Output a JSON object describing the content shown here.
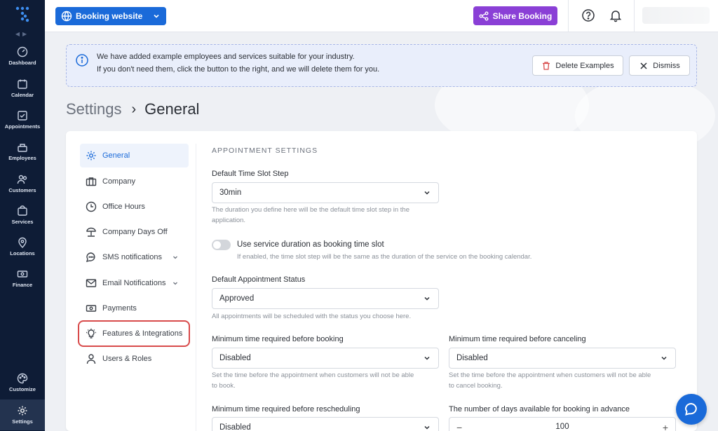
{
  "rail": {
    "items": [
      {
        "label": "Dashboard",
        "icon": "dashboard-icon"
      },
      {
        "label": "Calendar",
        "icon": "calendar-icon"
      },
      {
        "label": "Appointments",
        "icon": "appointments-icon"
      },
      {
        "label": "Employees",
        "icon": "employees-icon"
      },
      {
        "label": "Customers",
        "icon": "customers-icon"
      },
      {
        "label": "Services",
        "icon": "services-icon"
      },
      {
        "label": "Locations",
        "icon": "location-pin-icon"
      },
      {
        "label": "Finance",
        "icon": "finance-icon"
      }
    ],
    "bottom": [
      {
        "label": "Customize",
        "icon": "palette-icon"
      },
      {
        "label": "Settings",
        "icon": "gear-icon"
      }
    ]
  },
  "topbar": {
    "booking_label": "Booking website",
    "share_label": "Share Booking",
    "colors": {
      "primary": "#1a6ad9",
      "share": "#8a3fd6"
    }
  },
  "notice": {
    "line1": "We have added example employees and services suitable for your industry.",
    "line2": "If you don't need them, click the button to the right, and we will delete them for you.",
    "delete_label": "Delete Examples",
    "dismiss_label": "Dismiss"
  },
  "breadcrumb": {
    "root": "Settings",
    "current": "General",
    "separator": "›"
  },
  "settings_nav": [
    {
      "label": "General",
      "icon": "gear-icon",
      "active": true
    },
    {
      "label": "Company",
      "icon": "briefcase-icon"
    },
    {
      "label": "Office Hours",
      "icon": "clock-icon"
    },
    {
      "label": "Company Days Off",
      "icon": "umbrella-beach-icon"
    },
    {
      "label": "SMS notifications",
      "icon": "chat-bubble-icon",
      "expandable": true
    },
    {
      "label": "Email Notifications",
      "icon": "envelope-icon",
      "expandable": true
    },
    {
      "label": "Payments",
      "icon": "cash-icon"
    },
    {
      "label": "Features & Integrations",
      "icon": "lightbulb-icon",
      "highlighted": true
    },
    {
      "label": "Users & Roles",
      "icon": "user-icon"
    }
  ],
  "form": {
    "section_title": "APPOINTMENT SETTINGS",
    "time_slot": {
      "label": "Default Time Slot Step",
      "value": "30min",
      "help1": "The duration you define here will be the default time slot step in the",
      "help2": "application."
    },
    "service_duration_toggle": {
      "label": "Use service duration as booking time slot",
      "help": "If enabled, the time slot step will be the same as the duration of the service on the booking calendar.",
      "enabled": false
    },
    "appointment_status": {
      "label": "Default Appointment Status",
      "value": "Approved",
      "help": "All appointments will be scheduled with the status you choose here."
    },
    "min_before_booking": {
      "label": "Minimum time required before booking",
      "value": "Disabled",
      "help1": "Set the time before the appointment when customers will not be able",
      "help2": "to book."
    },
    "min_before_canceling": {
      "label": "Minimum time required before canceling",
      "value": "Disabled",
      "help1": "Set the time before the appointment when customers will not be able",
      "help2": "to cancel booking."
    },
    "min_before_rescheduling": {
      "label": "Minimum time required before rescheduling",
      "value": "Disabled"
    },
    "days_in_advance": {
      "label": "The number of days available for booking in advance",
      "value": "100",
      "minus": "−",
      "plus": "+"
    }
  }
}
